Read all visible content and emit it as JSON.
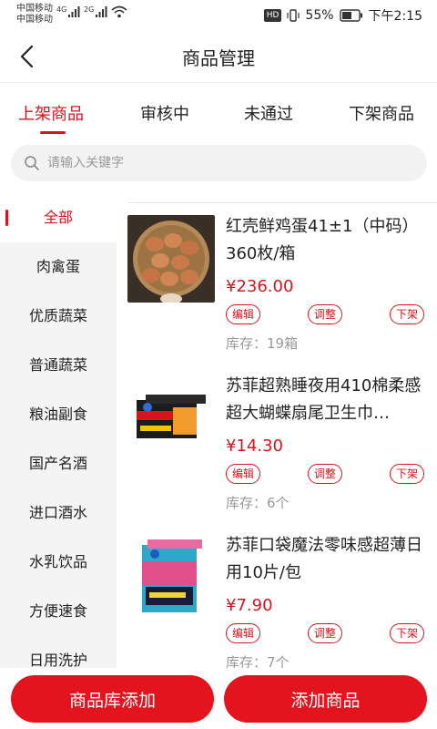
{
  "status_bar": {
    "carrier_1": "中国移动",
    "carrier_2": "中国移动",
    "sig_1": "4G",
    "sig_2": "2G",
    "hd": "HD",
    "battery": "55%",
    "time": "下午2:15"
  },
  "header": {
    "title": "商品管理"
  },
  "tabs": [
    {
      "label": "上架商品",
      "active": true
    },
    {
      "label": "审核中"
    },
    {
      "label": "未通过"
    },
    {
      "label": "下架商品"
    }
  ],
  "search": {
    "placeholder": "请输入关键字"
  },
  "sidebar": {
    "items": [
      {
        "label": "全部",
        "active": true
      },
      {
        "label": "肉禽蛋"
      },
      {
        "label": "优质蔬菜"
      },
      {
        "label": "普通蔬菜"
      },
      {
        "label": "粮油副食"
      },
      {
        "label": "国产名酒"
      },
      {
        "label": "进口酒水"
      },
      {
        "label": "水乳饮品"
      },
      {
        "label": "方便速食"
      },
      {
        "label": "日用洗护"
      }
    ]
  },
  "products": [
    {
      "name": "红壳鲜鸡蛋41±1（中码）360枚/箱",
      "price": "¥236.00",
      "edit": "编辑",
      "adjust": "调整",
      "off_shelf": "下架",
      "stock": "库存：19箱"
    },
    {
      "name": "苏菲超熟睡夜用410棉柔感超大蝴蝶扇尾卫生巾…",
      "price": "¥14.30",
      "edit": "编辑",
      "adjust": "调整",
      "off_shelf": "下架",
      "stock": "库存：6个"
    },
    {
      "name": "苏菲口袋魔法零味感超薄日用10片/包",
      "price": "¥7.90",
      "edit": "编辑",
      "adjust": "调整",
      "off_shelf": "下架",
      "stock": "库存：7个"
    }
  ],
  "bottom": {
    "library_add": "商品库添加",
    "add_product": "添加商品"
  },
  "colors": {
    "accent": "#d8141e",
    "button": "#e4141e"
  }
}
